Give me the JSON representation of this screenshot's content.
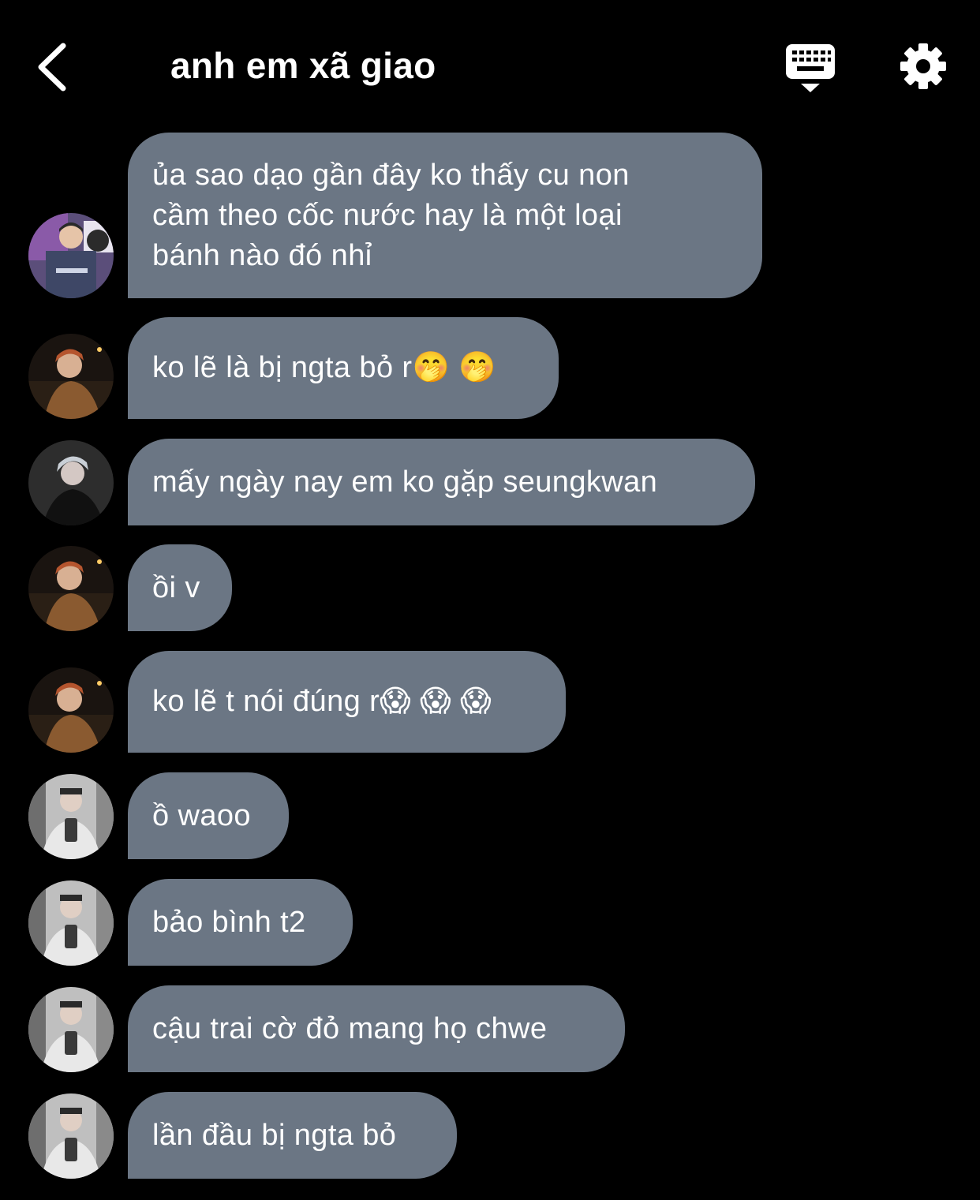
{
  "header": {
    "title": "anh em xã giao",
    "back_icon": "chevron-left-icon",
    "keyboard_icon": "keyboard-icon",
    "settings_icon": "gear-icon"
  },
  "colors": {
    "background": "#000000",
    "bubble": "#6b7684",
    "text": "#ffffff"
  },
  "messages": [
    {
      "text": "ủa sao dạo gần đây ko thấy cu non\ncầm theo cốc nước hay là một loại\nbánh nào đó nhỉ",
      "avatar": "avatar-hoodie-neon"
    },
    {
      "text": "ko lẽ là bị ngta bỏ r🤭 🤭",
      "avatar": "avatar-orange-hair"
    },
    {
      "text": "mấy ngày nay em ko gặp seungkwan",
      "avatar": "avatar-silver-hair"
    },
    {
      "text": "ồi v",
      "avatar": "avatar-orange-hair"
    },
    {
      "text": "ko lẽ t nói đúng r😱 😱 😱",
      "avatar": "avatar-orange-hair"
    },
    {
      "text": "ồ waoo",
      "avatar": "avatar-mirror-selfie"
    },
    {
      "text": "bảo bình t2",
      "avatar": "avatar-mirror-selfie"
    },
    {
      "text": "cậu trai cờ đỏ mang họ chwe",
      "avatar": "avatar-mirror-selfie"
    },
    {
      "text": "lần đầu bị ngta bỏ",
      "avatar": "avatar-mirror-selfie"
    }
  ]
}
